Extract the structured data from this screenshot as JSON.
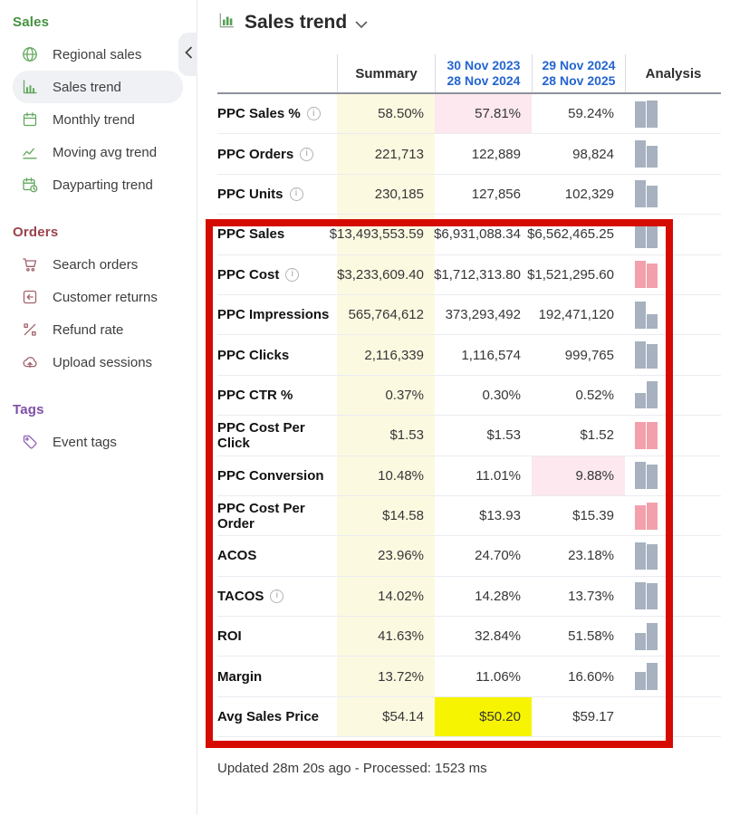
{
  "colors": {
    "sales_green": "#44923f",
    "sales_icon_green": "#63a85e",
    "orders_red": "#99434d",
    "orders_icon_red": "#a2606a",
    "tags_purple": "#7f4fa8",
    "tags_icon_purple": "#8f63b5",
    "date_blue": "#2465cf",
    "summary_bg": "#fcf9e1",
    "pink_bg": "#fce8ee",
    "highlight_yellow": "#f7f402",
    "bar_gray": "#a7b1bf",
    "bar_red": "#f2a0ab",
    "annotation_red": "#d60b00"
  },
  "sidebar": {
    "sections": [
      {
        "title": "Sales",
        "color": "#44923f",
        "icon_color": "#63a85e",
        "items": [
          {
            "label": "Regional sales",
            "icon": "globe",
            "selected": false
          },
          {
            "label": "Sales trend",
            "icon": "bar-chart",
            "selected": true
          },
          {
            "label": "Monthly trend",
            "icon": "calendar",
            "selected": false
          },
          {
            "label": "Moving avg trend",
            "icon": "line-chart",
            "selected": false
          },
          {
            "label": "Dayparting trend",
            "icon": "calendar-clock",
            "selected": false
          }
        ]
      },
      {
        "title": "Orders",
        "color": "#99434d",
        "icon_color": "#a2606a",
        "items": [
          {
            "label": "Search orders",
            "icon": "cart",
            "selected": false
          },
          {
            "label": "Customer returns",
            "icon": "return-arrow",
            "selected": false
          },
          {
            "label": "Refund rate",
            "icon": "percent",
            "selected": false
          },
          {
            "label": "Upload sessions",
            "icon": "cloud-upload",
            "selected": false
          }
        ]
      },
      {
        "title": "Tags",
        "color": "#7f4fa8",
        "icon_color": "#8f63b5",
        "items": [
          {
            "label": "Event tags",
            "icon": "tag",
            "selected": false
          }
        ]
      }
    ]
  },
  "header": {
    "title": "Sales trend"
  },
  "table": {
    "col_summary": "Summary",
    "col_period1": [
      "30 Nov 2023",
      "28 Nov 2024"
    ],
    "col_period2": [
      "29 Nov 2024",
      "28 Nov 2025"
    ],
    "col_analysis": "Analysis",
    "info_icon_glyph": "i",
    "rows": [
      {
        "metric": "PPC Sales %",
        "info": true,
        "summary": "58.50%",
        "p1": "57.81%",
        "p2": "59.24%",
        "p1_bg": "pink",
        "p2_bg": null,
        "bars": {
          "color": "gray",
          "values": [
            0.98,
            1
          ]
        }
      },
      {
        "metric": "PPC Orders",
        "info": true,
        "summary": "221,713",
        "p1": "122,889",
        "p2": "98,824",
        "p1_bg": null,
        "p2_bg": null,
        "bars": {
          "color": "gray",
          "values": [
            1,
            0.8
          ]
        }
      },
      {
        "metric": "PPC Units",
        "info": true,
        "summary": "230,185",
        "p1": "127,856",
        "p2": "102,329",
        "p1_bg": null,
        "p2_bg": null,
        "bars": {
          "color": "gray",
          "values": [
            1,
            0.8
          ]
        }
      },
      {
        "metric": "PPC Sales",
        "info": false,
        "summary": "$13,493,553.59",
        "p1": "$6,931,088.34",
        "p2": "$6,562,465.25",
        "p1_bg": null,
        "p2_bg": null,
        "bars": {
          "color": "gray",
          "values": [
            1,
            0.95
          ]
        }
      },
      {
        "metric": "PPC Cost",
        "info": true,
        "summary": "$3,233,609.40",
        "p1": "$1,712,313.80",
        "p2": "$1,521,295.60",
        "p1_bg": null,
        "p2_bg": null,
        "bars": {
          "color": "red",
          "values": [
            1,
            0.89
          ]
        }
      },
      {
        "metric": "PPC Impressions",
        "info": false,
        "summary": "565,764,612",
        "p1": "373,293,492",
        "p2": "192,471,120",
        "p1_bg": null,
        "p2_bg": null,
        "bars": {
          "color": "gray",
          "values": [
            1,
            0.52
          ]
        }
      },
      {
        "metric": "PPC Clicks",
        "info": false,
        "summary": "2,116,339",
        "p1": "1,116,574",
        "p2": "999,765",
        "p1_bg": null,
        "p2_bg": null,
        "bars": {
          "color": "gray",
          "values": [
            1,
            0.9
          ]
        }
      },
      {
        "metric": "PPC CTR %",
        "info": false,
        "summary": "0.37%",
        "p1": "0.30%",
        "p2": "0.52%",
        "p1_bg": null,
        "p2_bg": null,
        "bars": {
          "color": "gray",
          "values": [
            0.58,
            1
          ]
        }
      },
      {
        "metric": "PPC Cost Per Click",
        "info": false,
        "summary": "$1.53",
        "p1": "$1.53",
        "p2": "$1.52",
        "p1_bg": null,
        "p2_bg": null,
        "bars": {
          "color": "red",
          "values": [
            1,
            0.99
          ]
        }
      },
      {
        "metric": "PPC Conversion",
        "info": false,
        "summary": "10.48%",
        "p1": "11.01%",
        "p2": "9.88%",
        "p1_bg": null,
        "p2_bg": "pink",
        "bars": {
          "color": "gray",
          "values": [
            1,
            0.9
          ]
        }
      },
      {
        "metric": "PPC Cost Per Order",
        "info": false,
        "summary": "$14.58",
        "p1": "$13.93",
        "p2": "$15.39",
        "p1_bg": null,
        "p2_bg": null,
        "bars": {
          "color": "red",
          "values": [
            0.91,
            1
          ]
        }
      },
      {
        "metric": "ACOS",
        "info": false,
        "summary": "23.96%",
        "p1": "24.70%",
        "p2": "23.18%",
        "p1_bg": null,
        "p2_bg": null,
        "bars": {
          "color": "gray",
          "values": [
            1,
            0.94
          ]
        }
      },
      {
        "metric": "TACOS",
        "info": true,
        "summary": "14.02%",
        "p1": "14.28%",
        "p2": "13.73%",
        "p1_bg": null,
        "p2_bg": null,
        "bars": {
          "color": "gray",
          "values": [
            1,
            0.96
          ]
        }
      },
      {
        "metric": "ROI",
        "info": false,
        "summary": "41.63%",
        "p1": "32.84%",
        "p2": "51.58%",
        "p1_bg": null,
        "p2_bg": null,
        "bars": {
          "color": "gray",
          "values": [
            0.64,
            1
          ]
        }
      },
      {
        "metric": "Margin",
        "info": false,
        "summary": "13.72%",
        "p1": "11.06%",
        "p2": "16.60%",
        "p1_bg": null,
        "p2_bg": null,
        "bars": {
          "color": "gray",
          "values": [
            0.67,
            1
          ]
        }
      },
      {
        "metric": "Avg Sales Price",
        "info": false,
        "summary": "$54.14",
        "p1": "$50.20",
        "p2": "$59.17",
        "p1_bg": "yellow",
        "p2_bg": null,
        "bars": null
      }
    ]
  },
  "footer": {
    "status": "Updated 28m 20s ago - Processed: 1523 ms"
  }
}
